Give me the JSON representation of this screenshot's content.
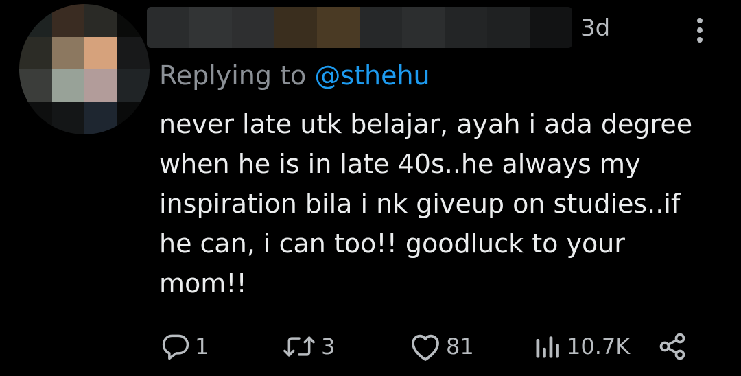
{
  "tweet": {
    "timestamp": "3d",
    "replying_prefix": "Replying to ",
    "replying_handle": "@sthehu",
    "body_lines": [
      "never late utk belajar, ayah i ada degree",
      "when he is in late 40s..he always my",
      "inspiration bila i nk giveup on studies..if",
      "he can, i can too!! goodluck to your",
      "mom!!"
    ]
  },
  "actions": {
    "reply": {
      "icon": "reply-icon",
      "count": "1"
    },
    "retweet": {
      "icon": "retweet-icon",
      "count": "3"
    },
    "like": {
      "icon": "heart-icon",
      "count": "81"
    },
    "views": {
      "icon": "views-icon",
      "count": "10.7K"
    },
    "share": {
      "icon": "share-icon"
    }
  },
  "colors": {
    "background": "#000000",
    "text": "#e7e9ea",
    "muted": "#8b9096",
    "link": "#1d9bf0",
    "icon": "#b8bcc0"
  }
}
